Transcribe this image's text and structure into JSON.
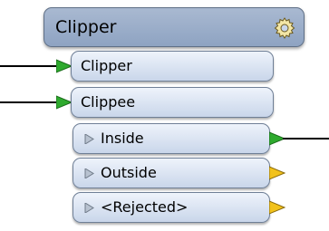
{
  "node": {
    "title": "Clipper",
    "input_ports": [
      {
        "label": "Clipper"
      },
      {
        "label": "Clippee"
      }
    ],
    "output_ports": [
      {
        "label": "Inside",
        "connected": true
      },
      {
        "label": "Outside",
        "connected": false
      },
      {
        "label": "<Rejected>",
        "connected": false
      }
    ]
  },
  "colors": {
    "header": "#9aadc9",
    "port": "#dde6f3",
    "connected_arrow": "#2eaa2e",
    "unconnected_arrow": "#f2c21b"
  },
  "icons": {
    "settings": "gear-icon",
    "expander": "triangle-right-icon"
  }
}
